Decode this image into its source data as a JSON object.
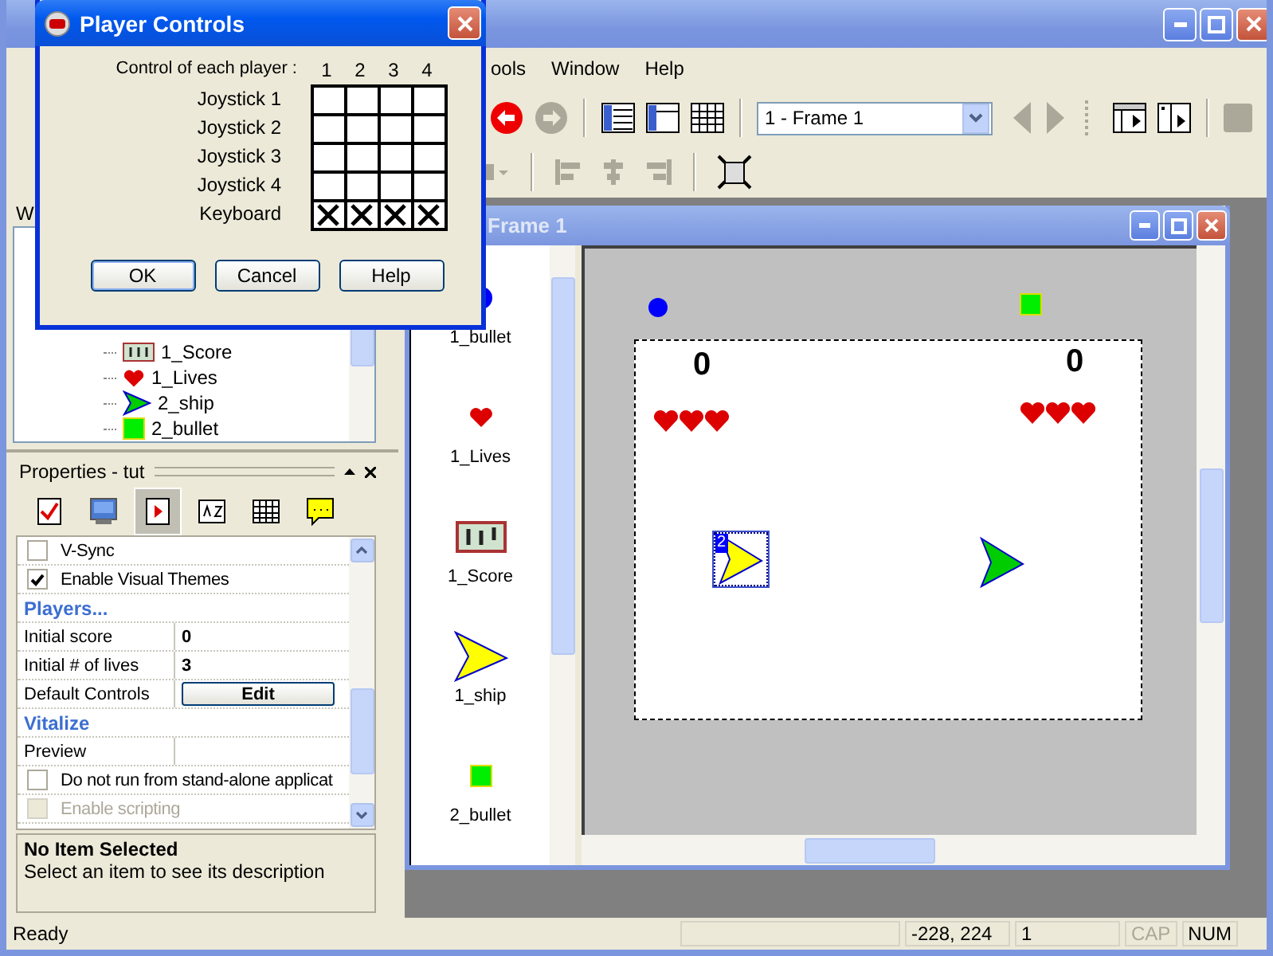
{
  "menu": [
    "ools",
    "Window",
    "Help"
  ],
  "toolbar": {
    "frame_select": "1 - Frame 1"
  },
  "tree": {
    "title": "W",
    "items": [
      {
        "label": "1_Score",
        "kind": "score"
      },
      {
        "label": "1_Lives",
        "kind": "heart"
      },
      {
        "label": "2_ship",
        "kind": "ship_green"
      },
      {
        "label": "2_bullet",
        "kind": "square"
      }
    ]
  },
  "properties": {
    "title": "Properties - tut",
    "tabs": [
      {
        "selected": false
      },
      {
        "selected": false
      },
      {
        "selected": true
      },
      {
        "selected": false
      },
      {
        "selected": false
      },
      {
        "selected": false
      }
    ],
    "rows": [
      {
        "kind": "checkbox",
        "label": "V-Sync",
        "checked": false,
        "disabled": false
      },
      {
        "kind": "checkbox",
        "label": "Enable Visual Themes",
        "checked": true,
        "disabled": false
      },
      {
        "kind": "section",
        "label": "Players..."
      },
      {
        "kind": "value",
        "label": "Initial score",
        "value": "0"
      },
      {
        "kind": "value",
        "label": "Initial # of lives",
        "value": "3"
      },
      {
        "kind": "button",
        "label": "Default Controls",
        "button": "Edit"
      },
      {
        "kind": "section",
        "label": "Vitalize"
      },
      {
        "kind": "value",
        "label": "Preview"
      },
      {
        "kind": "checkbox",
        "label": "Do not run from stand-alone applicat",
        "checked": false,
        "disabled": false
      },
      {
        "kind": "checkbox",
        "label": "Enable scripting",
        "checked": false,
        "disabled": true
      }
    ],
    "description": {
      "title": "No Item Selected",
      "text": "Select an item to see its description"
    }
  },
  "frame_window": {
    "title": "Frame 1",
    "library": [
      {
        "label": "1_bullet",
        "kind": "dot"
      },
      {
        "label": "1_Lives",
        "kind": "heart"
      },
      {
        "label": "1_Score",
        "kind": "score"
      },
      {
        "label": "1_ship",
        "kind": "ship_yellow"
      },
      {
        "label": "2_bullet",
        "kind": "square"
      }
    ],
    "objects": [
      {
        "kind": "dot"
      },
      {
        "kind": "square"
      },
      {
        "kind": "score",
        "text": "0"
      },
      {
        "kind": "score",
        "text": "0"
      },
      {
        "kind": "hearts"
      },
      {
        "kind": "hearts"
      },
      {
        "kind": "ship_yellow",
        "selected": true,
        "badge": "2"
      },
      {
        "kind": "ship_green",
        "selected": false
      }
    ]
  },
  "dialog": {
    "title": "Player Controls",
    "header": "Control of each player :",
    "players": [
      "1",
      "2",
      "3",
      "4"
    ],
    "rows": [
      {
        "label": "Joystick 1",
        "cells": [
          {
            "checked": false
          },
          {
            "checked": false
          },
          {
            "checked": false
          },
          {
            "checked": false
          }
        ]
      },
      {
        "label": "Joystick 2",
        "cells": [
          {
            "checked": false
          },
          {
            "checked": false
          },
          {
            "checked": false
          },
          {
            "checked": false
          }
        ]
      },
      {
        "label": "Joystick 3",
        "cells": [
          {
            "checked": false
          },
          {
            "checked": false
          },
          {
            "checked": false
          },
          {
            "checked": false
          }
        ]
      },
      {
        "label": "Joystick 4",
        "cells": [
          {
            "checked": false
          },
          {
            "checked": false
          },
          {
            "checked": false
          },
          {
            "checked": false
          }
        ]
      },
      {
        "label": "Keyboard",
        "cells": [
          {
            "checked": true
          },
          {
            "checked": true
          },
          {
            "checked": true
          },
          {
            "checked": true
          }
        ]
      }
    ],
    "buttons": [
      "OK",
      "Cancel",
      "Help"
    ]
  },
  "status_bar": {
    "message": "Ready",
    "panes": [
      {
        "text": "-228, 224",
        "disabled": false
      },
      {
        "text": "1",
        "disabled": false
      },
      {
        "text": "CAP",
        "disabled": true
      },
      {
        "text": "NUM",
        "disabled": false
      }
    ]
  }
}
